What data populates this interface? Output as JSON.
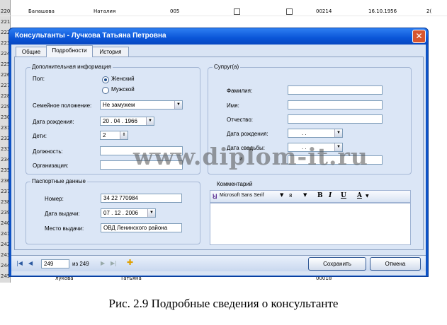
{
  "background_rows": {
    "row_numbers": [
      "220",
      "221",
      "222",
      "223",
      "224",
      "225",
      "226",
      "227",
      "228",
      "229",
      "230",
      "231",
      "232",
      "233",
      "234",
      "235",
      "236",
      "237",
      "238",
      "239",
      "240",
      "241",
      "242",
      "243",
      "244",
      "245"
    ],
    "top_row": {
      "last": "Балашова",
      "first": "Наталия",
      "code": "005",
      "num": "00214",
      "date": "16.10.1956",
      "extra": "2("
    },
    "bottom_row": {
      "last": "лукова",
      "first": "Татьяна",
      "num": "00018"
    }
  },
  "window": {
    "title": "Консультанты - Лучкова Татьяна Петровна",
    "close_glyph": "✕"
  },
  "tabs": [
    "Общие",
    "Подробности",
    "История"
  ],
  "additional_info": {
    "title": "Дополнительная информация",
    "gender_label": "Пол:",
    "gender_female": "Женский",
    "gender_male": "Мужской",
    "gender_selected": "Женский",
    "marital_label": "Семейное положение:",
    "marital_value": "Не замужем",
    "birthdate_label": "Дата рождения:",
    "birthdate_value": "20 . 04 . 1966",
    "children_label": "Дети:",
    "children_value": "2",
    "position_label": "Должность:",
    "position_value": "",
    "organization_label": "Организация:",
    "organization_value": ""
  },
  "passport": {
    "title": "Паспортные данные",
    "number_label": "Номер:",
    "number_value": "34 22 770984",
    "issue_date_label": "Дата выдачи:",
    "issue_date_value": "07 . 12 . 2006",
    "issue_place_label": "Место выдачи:",
    "issue_place_value": "ОВД Ленинского района"
  },
  "spouse": {
    "title": "Супруг(а)",
    "last_name_label": "Фамилия:",
    "first_name_label": "Имя:",
    "middle_name_label": "Отчество:",
    "birthdate_label": "Дата рождения:",
    "birthdate_value": ".  .",
    "wedding_label": "Дата свадьбы:",
    "wedding_value": ".  .",
    "partial_label": "и"
  },
  "comment": {
    "title": "Комментарий",
    "font_value": "Microsoft Sans Serif",
    "size_value": "8",
    "bold": "B",
    "italic": "I",
    "underline": "U",
    "color": "A"
  },
  "navigator": {
    "current": "249",
    "of_text": "из 249"
  },
  "buttons": {
    "save": "Сохранить",
    "cancel": "Отмена"
  },
  "watermark": "www.diplom-it.ru",
  "caption": "Рис. 2.9 Подробные сведения о консультанте"
}
